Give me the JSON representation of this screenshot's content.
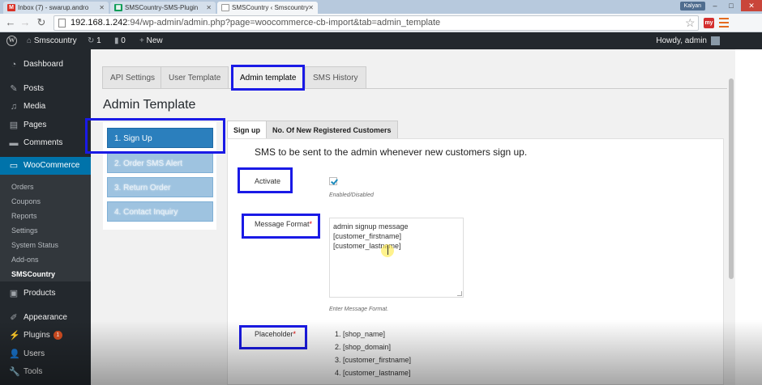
{
  "browser": {
    "tabs": [
      {
        "label": "Inbox (7) - swarup.andro",
        "icon": "gmail-icon",
        "active": false
      },
      {
        "label": "SMSCountry-SMS-Plugin",
        "icon": "sheets-icon",
        "active": false
      },
      {
        "label": "SMSCountry ‹ Smscountry",
        "icon": "page-icon",
        "active": true
      }
    ],
    "user_badge": "Kalyan",
    "url_host": "192.168.1.242",
    "url_rest": ":94/wp-admin/admin.php?page=woocommerce-cb-import&tab=admin_template",
    "extension_label": "my"
  },
  "adminbar": {
    "site_name": "Smscountry",
    "updates_count": "1",
    "comments_count": "0",
    "new_label": "New",
    "howdy": "Howdy, admin"
  },
  "sidebar": {
    "items": [
      {
        "label": "Dashboard",
        "icon": "dashboard-icon"
      },
      {
        "label": "Posts",
        "icon": "pin-icon"
      },
      {
        "label": "Media",
        "icon": "media-icon"
      },
      {
        "label": "Pages",
        "icon": "pages-icon"
      },
      {
        "label": "Comments",
        "icon": "comment-icon"
      },
      {
        "label": "WooCommerce",
        "icon": "woocommerce-icon",
        "current": true
      },
      {
        "label": "Products",
        "icon": "products-icon"
      },
      {
        "label": "Appearance",
        "icon": "brush-icon"
      },
      {
        "label": "Plugins",
        "icon": "plugin-icon",
        "badge": "1"
      },
      {
        "label": "Users",
        "icon": "user-icon"
      },
      {
        "label": "Tools",
        "icon": "wrench-icon"
      }
    ],
    "submenu": [
      "Orders",
      "Coupons",
      "Reports",
      "Settings",
      "System Status",
      "Add-ons",
      "SMSCountry"
    ]
  },
  "main": {
    "nav_tabs": [
      "API Settings",
      "User Template",
      "Admin template",
      "SMS History"
    ],
    "active_nav_tab": "Admin template",
    "heading": "Admin Template",
    "steps": [
      "1. Sign Up",
      "2. Order SMS Alert",
      "3. Return Order",
      "4. Contact Inquiry"
    ],
    "inner_tabs": [
      "Sign up",
      "No. Of New Registered Customers"
    ],
    "panel": {
      "description": "SMS to be sent to the admin whenever new customers sign up.",
      "activate_label": "Activate",
      "activate_checked": true,
      "activate_hint": "Enabled/Disabled",
      "message_label": "Message Format",
      "message_value": "admin signup message\n[customer_firstname]\n[customer_lastname]",
      "message_hint": "Enter Message Format.",
      "placeholder_label": "Placeholder",
      "required_mark": "*",
      "placeholders": [
        "1. [shop_name]",
        "2. [shop_domain]",
        "3. [customer_firstname]",
        "4. [customer_lastname]"
      ]
    }
  },
  "colors": {
    "highlight": "#1a1ae6",
    "wp_blue": "#0073aa",
    "adminbar": "#23282d",
    "step_active": "#2b7fbd",
    "step_inactive": "#9ec3e0"
  }
}
